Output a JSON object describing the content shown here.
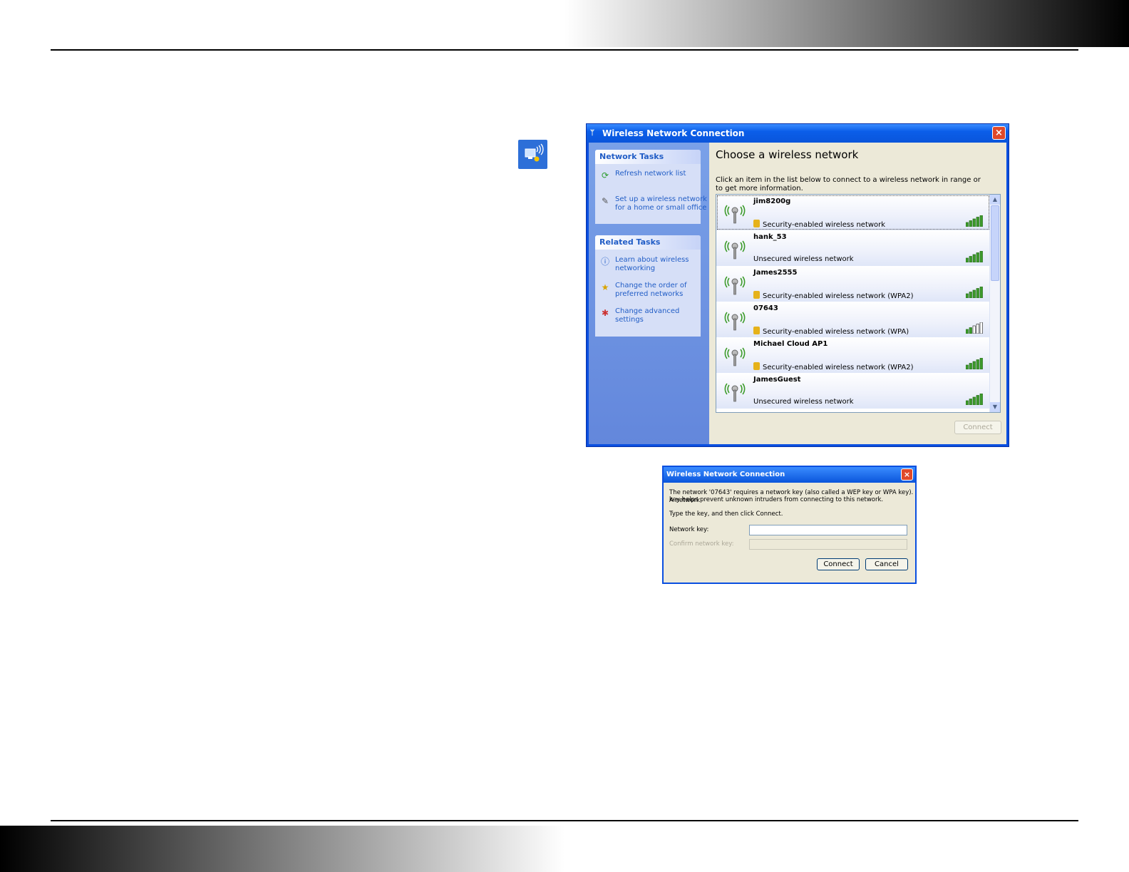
{
  "tray": {
    "icon": "wireless-network-tray-icon"
  },
  "main_window": {
    "title": "Wireless Network Connection",
    "close_label": "×",
    "network_tasks": {
      "header": "Network Tasks",
      "items": [
        {
          "label": "Refresh network list",
          "icon": "refresh-icon"
        },
        {
          "label": "Set up a wireless network for a home or small office",
          "icon": "setup-wireless-icon"
        }
      ]
    },
    "related_tasks": {
      "header": "Related Tasks",
      "items": [
        {
          "label": "Learn about wireless networking",
          "icon": "info-icon"
        },
        {
          "label": "Change the order of preferred networks",
          "icon": "star-icon"
        },
        {
          "label": "Change advanced settings",
          "icon": "settings-icon"
        }
      ]
    },
    "heading": "Choose a wireless network",
    "instruction": "Click an item in the list below to connect to a wireless network in range or to get more information.",
    "networks": [
      {
        "name": "jim8200g",
        "description": "Security-enabled wireless network",
        "secured": true,
        "signal": 5,
        "selected": true
      },
      {
        "name": "hank_53",
        "description": "Unsecured wireless network",
        "secured": false,
        "signal": 5
      },
      {
        "name": "James2555",
        "description": "Security-enabled wireless network (WPA2)",
        "secured": true,
        "signal": 5
      },
      {
        "name": "07643",
        "description": "Security-enabled wireless network (WPA)",
        "secured": true,
        "signal": 2
      },
      {
        "name": "Michael Cloud AP1",
        "description": "Security-enabled wireless network (WPA2)",
        "secured": true,
        "signal": 5
      },
      {
        "name": "JamesGuest",
        "description": "Unsecured wireless network",
        "secured": false,
        "signal": 5
      }
    ],
    "connect_button": "Connect",
    "colors": {
      "title_blue": "#0a55db",
      "signal_green": "#3c9b2a",
      "link_blue": "#215dc6"
    }
  },
  "key_dialog": {
    "title": "Wireless Network Connection",
    "close_label": "×",
    "message_line1": "The network '07643' requires a network key (also called a WEP key or WPA key). A network",
    "message_line2": "key helps prevent unknown intruders from connecting to this network.",
    "prompt": "Type the key, and then click Connect.",
    "network_key_label": "Network key:",
    "network_key_value": "",
    "confirm_key_label": "Confirm network key:",
    "confirm_key_value": "",
    "connect_button": "Connect",
    "cancel_button": "Cancel"
  }
}
